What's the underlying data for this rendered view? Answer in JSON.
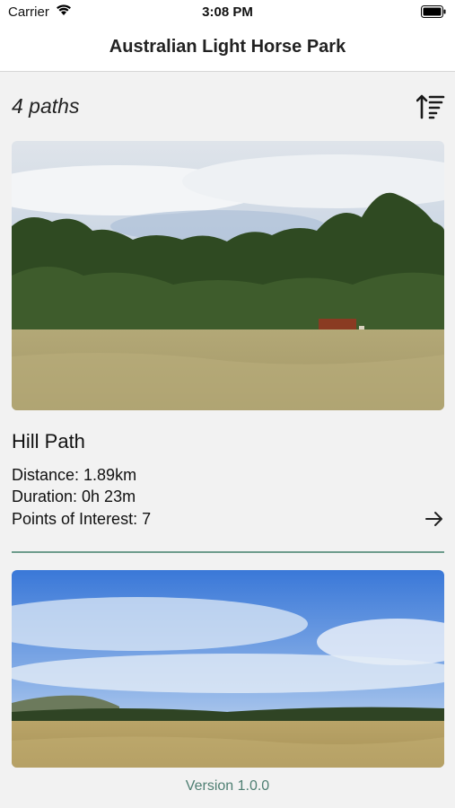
{
  "status": {
    "carrier": "Carrier",
    "time": "3:08 PM"
  },
  "nav": {
    "title": "Australian Light Horse Park"
  },
  "list": {
    "count_label": "4 paths",
    "items": [
      {
        "name": "Hill Path",
        "distance": "Distance: 1.89km",
        "duration": "Duration: 0h 23m",
        "poi": "Points of Interest: 7"
      }
    ]
  },
  "footer": {
    "version": "Version 1.0.0"
  },
  "colors": {
    "accent": "#4f7f73",
    "divider": "#6e9c8c"
  },
  "icons": {
    "sort": "sort-ascending-icon",
    "arrow": "arrow-right-icon"
  }
}
